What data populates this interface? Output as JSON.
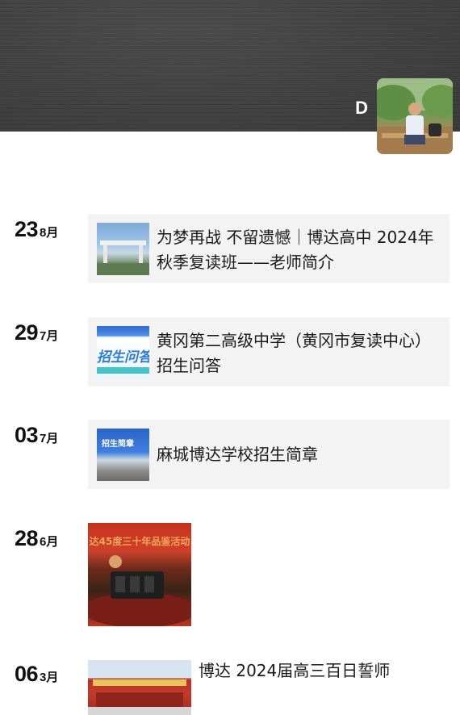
{
  "profile": {
    "nickname": "D",
    "avatar_icon": "avatar-photo"
  },
  "posts": [
    {
      "day": "23",
      "month": "8月",
      "title": "为梦再战 不留遗憾｜博达高中 2024年秋季复读班——老师简介",
      "thumb_icon": "school-gate-photo"
    },
    {
      "day": "29",
      "month": "7月",
      "title": "黄冈第二高级中学（黄冈市复读中心）招生问答",
      "thumb_icon": "admission-qa-banner",
      "thumb_text": "招生问答"
    },
    {
      "day": "03",
      "month": "7月",
      "title": "麻城博达学校招生简章",
      "thumb_icon": "admission-brochure-banner",
      "thumb_text": "招生简章"
    },
    {
      "day": "28",
      "month": "6月",
      "photo_icon": "event-banquet-photo",
      "photo_text": "达45度三十年品鉴活动"
    },
    {
      "day": "06",
      "month": "3月",
      "title": "博达 2024届高三百日誓师",
      "photo_icon": "rally-ceremony-photo"
    }
  ]
}
